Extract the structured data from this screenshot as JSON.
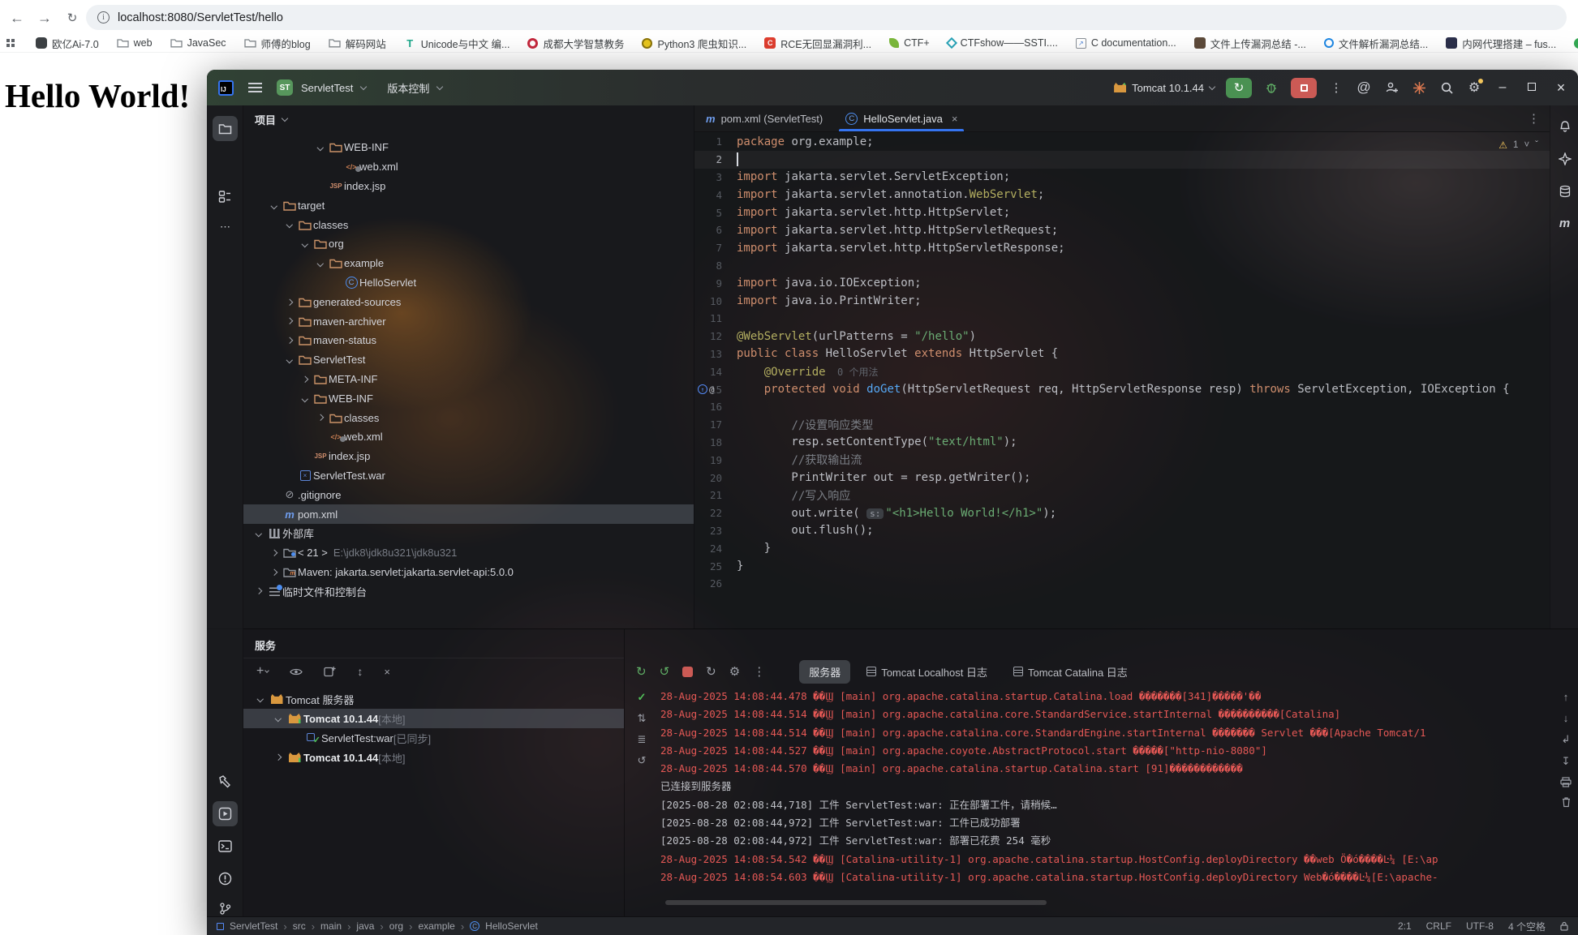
{
  "browser": {
    "url": "localhost:8080/ServletTest/hello",
    "page_heading": "Hello World!",
    "bookmarks": [
      {
        "icon": "ai-badge",
        "label": "欧亿Ai-7.0"
      },
      {
        "icon": "folder",
        "label": "web"
      },
      {
        "icon": "folder",
        "label": "JavaSec"
      },
      {
        "icon": "folder",
        "label": "师傅的blog"
      },
      {
        "icon": "folder",
        "label": "解码网站"
      },
      {
        "icon": "unicode-tool",
        "label": "Unicode与中文 编..."
      },
      {
        "icon": "red-ring",
        "label": "成都大学智慧教务"
      },
      {
        "icon": "python",
        "label": "Python3 爬虫知识..."
      },
      {
        "icon": "red-c",
        "label": "RCE无回显漏洞利..."
      },
      {
        "icon": "green-leaf",
        "label": "CTF+"
      },
      {
        "icon": "teal-diamond",
        "label": "CTFshow——SSTI...."
      },
      {
        "icon": "gray-doc",
        "label": "C documentation..."
      },
      {
        "icon": "dark-square",
        "label": "文件上传漏洞总结 -..."
      },
      {
        "icon": "blue-ring",
        "label": "文件解析漏洞总结..."
      },
      {
        "icon": "navy-square",
        "label": "内网代理搭建 – fus..."
      },
      {
        "icon": "green-dot",
        "label": ""
      }
    ]
  },
  "ide": {
    "title_bar": {
      "project_badge": "ST",
      "project_name": "ServletTest",
      "vcs_label": "版本控制",
      "run_config": "Tomcat 10.1.44"
    },
    "project_panel": {
      "header": "项目",
      "tree": [
        {
          "indent": 4,
          "chevron": "open",
          "icon": "folder",
          "label": "WEB-INF"
        },
        {
          "indent": 5,
          "chevron": null,
          "icon": "xml",
          "label": "web.xml"
        },
        {
          "indent": 4,
          "chevron": null,
          "icon": "jsp",
          "label": "index.jsp"
        },
        {
          "indent": 1,
          "chevron": "open",
          "icon": "folder",
          "label": "target"
        },
        {
          "indent": 2,
          "chevron": "open",
          "icon": "folder",
          "label": "classes"
        },
        {
          "indent": 3,
          "chevron": "open",
          "icon": "folder",
          "label": "org"
        },
        {
          "indent": 4,
          "chevron": "open",
          "icon": "folder",
          "label": "example"
        },
        {
          "indent": 5,
          "chevron": null,
          "icon": "class",
          "label": "HelloServlet"
        },
        {
          "indent": 2,
          "chevron": "closed",
          "icon": "folder",
          "label": "generated-sources"
        },
        {
          "indent": 2,
          "chevron": "closed",
          "icon": "folder",
          "label": "maven-archiver"
        },
        {
          "indent": 2,
          "chevron": "closed",
          "icon": "folder",
          "label": "maven-status"
        },
        {
          "indent": 2,
          "chevron": "open",
          "icon": "folder",
          "label": "ServletTest"
        },
        {
          "indent": 3,
          "chevron": "closed",
          "icon": "folder",
          "label": "META-INF"
        },
        {
          "indent": 3,
          "chevron": "open",
          "icon": "folder",
          "label": "WEB-INF"
        },
        {
          "indent": 4,
          "chevron": "closed",
          "icon": "folder",
          "label": "classes"
        },
        {
          "indent": 4,
          "chevron": null,
          "icon": "xml",
          "label": "web.xml"
        },
        {
          "indent": 3,
          "chevron": null,
          "icon": "jsp",
          "label": "index.jsp"
        },
        {
          "indent": 2,
          "chevron": null,
          "icon": "war",
          "label": "ServletTest.war"
        },
        {
          "indent": 1,
          "chevron": null,
          "icon": "ignore",
          "label": ".gitignore"
        },
        {
          "indent": 1,
          "chevron": null,
          "icon": "maven",
          "label": "pom.xml",
          "selected": true
        },
        {
          "indent": 0,
          "chevron": "open",
          "icon": "lib",
          "label": "外部库"
        },
        {
          "indent": 1,
          "chevron": "closed",
          "icon": "jdk",
          "label": "< 21 >",
          "extra": "E:\\jdk8\\jdk8u321\\jdk8u321"
        },
        {
          "indent": 1,
          "chevron": "closed",
          "icon": "libfolder",
          "label": "Maven: jakarta.servlet:jakarta.servlet-api:5.0.0"
        },
        {
          "indent": 0,
          "chevron": "closed",
          "icon": "scratch",
          "label": "临时文件和控制台"
        }
      ]
    },
    "editor": {
      "tabs": [
        {
          "icon": "maven",
          "label": "pom.xml (ServletTest)",
          "active": false
        },
        {
          "icon": "class",
          "label": "HelloServlet.java",
          "active": true,
          "closable": true
        }
      ],
      "warning_badge": "1",
      "lines": [
        {
          "n": 1,
          "t": [
            [
              "kw",
              "package "
            ],
            [
              "pl",
              "org.example;"
            ]
          ]
        },
        {
          "n": 2,
          "t": [
            [
              "caret",
              ""
            ]
          ],
          "current": true
        },
        {
          "n": 3,
          "t": [
            [
              "kw",
              "import "
            ],
            [
              "pl",
              "jakarta.servlet.ServletException;"
            ]
          ]
        },
        {
          "n": 4,
          "t": [
            [
              "kw",
              "import "
            ],
            [
              "pl",
              "jakarta.servlet.annotation."
            ],
            [
              "ann",
              "WebServlet"
            ],
            [
              "pl",
              ";"
            ]
          ]
        },
        {
          "n": 5,
          "t": [
            [
              "kw",
              "import "
            ],
            [
              "pl",
              "jakarta.servlet.http.HttpServlet;"
            ]
          ]
        },
        {
          "n": 6,
          "t": [
            [
              "kw",
              "import "
            ],
            [
              "pl",
              "jakarta.servlet.http.HttpServletRequest;"
            ]
          ]
        },
        {
          "n": 7,
          "t": [
            [
              "kw",
              "import "
            ],
            [
              "pl",
              "jakarta.servlet.http.HttpServletResponse;"
            ]
          ]
        },
        {
          "n": 8,
          "t": []
        },
        {
          "n": 9,
          "t": [
            [
              "kw",
              "import "
            ],
            [
              "pl",
              "java.io.IOException;"
            ]
          ]
        },
        {
          "n": 10,
          "t": [
            [
              "kw",
              "import "
            ],
            [
              "pl",
              "java.io.PrintWriter;"
            ]
          ]
        },
        {
          "n": 11,
          "t": []
        },
        {
          "n": 12,
          "t": [
            [
              "ann",
              "@WebServlet"
            ],
            [
              "pl",
              "(urlPatterns = "
            ],
            [
              "str",
              "\"/hello\""
            ],
            [
              "pl",
              ")"
            ]
          ]
        },
        {
          "n": 13,
          "t": [
            [
              "kw",
              "public class "
            ],
            [
              "pl",
              "HelloServlet "
            ],
            [
              "kw",
              "extends "
            ],
            [
              "pl",
              "HttpServlet {"
            ]
          ]
        },
        {
          "n": 14,
          "t": [
            [
              "pl",
              "    "
            ],
            [
              "ann",
              "@Override"
            ],
            [
              "hint",
              "  0 个用法"
            ]
          ]
        },
        {
          "n": 15,
          "t": [
            [
              "pl",
              "    "
            ],
            [
              "kw",
              "protected void "
            ],
            [
              "mth",
              "doGet"
            ],
            [
              "pl",
              "(HttpServletRequest req, HttpServletResponse resp) "
            ],
            [
              "kw",
              "throws "
            ],
            [
              "pl",
              "ServletException, IOException {"
            ]
          ],
          "gutter": [
            "override",
            "annotation"
          ]
        },
        {
          "n": 16,
          "t": []
        },
        {
          "n": 17,
          "t": [
            [
              "pl",
              "        "
            ],
            [
              "cmt",
              "//设置响应类型"
            ]
          ]
        },
        {
          "n": 18,
          "t": [
            [
              "pl",
              "        resp.setContentType("
            ],
            [
              "str",
              "\"text/html\""
            ],
            [
              "pl",
              ");"
            ]
          ]
        },
        {
          "n": 19,
          "t": [
            [
              "pl",
              "        "
            ],
            [
              "cmt",
              "//获取输出流"
            ]
          ]
        },
        {
          "n": 20,
          "t": [
            [
              "pl",
              "        PrintWriter out = resp.getWriter();"
            ]
          ]
        },
        {
          "n": 21,
          "t": [
            [
              "pl",
              "        "
            ],
            [
              "cmt",
              "//写入响应"
            ]
          ]
        },
        {
          "n": 22,
          "t": [
            [
              "pl",
              "        out.write( "
            ],
            [
              "badge",
              "s:"
            ],
            [
              "str",
              "\"<h1>Hello World!</h1>\""
            ],
            [
              "pl",
              ");"
            ]
          ]
        },
        {
          "n": 23,
          "t": [
            [
              "pl",
              "        out.flush();"
            ]
          ]
        },
        {
          "n": 24,
          "t": [
            [
              "pl",
              "    }"
            ]
          ]
        },
        {
          "n": 25,
          "t": [
            [
              "pl",
              "}"
            ]
          ]
        },
        {
          "n": 26,
          "t": []
        }
      ]
    },
    "services_panel": {
      "title": "服务",
      "tree": [
        {
          "indent": 0,
          "chevron": "open",
          "icon": "tomcat",
          "label": "Tomcat 服务器",
          "extra": "",
          "bold": false
        },
        {
          "indent": 1,
          "chevron": "open",
          "icon": "tomcat-run",
          "label": "Tomcat 10.1.44",
          "extra": " [本地]",
          "bold": true,
          "selected": true
        },
        {
          "indent": 2,
          "chevron": null,
          "icon": "artifact-ok",
          "label": "ServletTest:war",
          "extra": " [已同步]",
          "bold": false
        },
        {
          "indent": 1,
          "chevron": "closed",
          "icon": "tomcat-run",
          "label": "Tomcat 10.1.44",
          "extra": " [本地]",
          "bold": true
        }
      ]
    },
    "console": {
      "tabs": [
        {
          "icon": null,
          "label": "服务器",
          "active": true
        },
        {
          "icon": "log",
          "label": "Tomcat Localhost 日志",
          "active": false
        },
        {
          "icon": "log",
          "label": "Tomcat Catalina 日志",
          "active": false
        }
      ],
      "logs": [
        {
          "c": "err",
          "text": "28-Aug-2025 14:08:44.478 ��Ϣ [main] org.apache.catalina.startup.Catalina.load �������[341]�����'��"
        },
        {
          "c": "err",
          "text": "28-Aug-2025 14:08:44.514 ��Ϣ [main] org.apache.catalina.core.StandardService.startInternal ����������[Catalina]"
        },
        {
          "c": "err",
          "text": "28-Aug-2025 14:08:44.514 ��Ϣ [main] org.apache.catalina.core.StandardEngine.startInternal ������� Servlet ���[Apache Tomcat/1"
        },
        {
          "c": "err",
          "text": "28-Aug-2025 14:08:44.527 ��Ϣ [main] org.apache.coyote.AbstractProtocol.start �����[\"http-nio-8080\"]"
        },
        {
          "c": "err",
          "text": "28-Aug-2025 14:08:44.570 ��Ϣ [main] org.apache.catalina.startup.Catalina.start [91]������������"
        },
        {
          "c": "std",
          "text": "已连接到服务器"
        },
        {
          "c": "std",
          "text": "[2025-08-28 02:08:44,718] 工件 ServletTest:war: 正在部署工件，请稍候…"
        },
        {
          "c": "std",
          "text": "[2025-08-28 02:08:44,972] 工件 ServletTest:war: 工件已成功部署"
        },
        {
          "c": "std",
          "text": "[2025-08-28 02:08:44,972] 工件 ServletTest:war: 部署已花费 254 毫秒"
        },
        {
          "c": "err",
          "text": "28-Aug-2025 14:08:54.542 ��Ϣ [Catalina-utility-1] org.apache.catalina.startup.HostConfig.deployDirectory ��web Ӧ�ó����Ŀ¼ [E:\\ap"
        },
        {
          "c": "err",
          "text": "28-Aug-2025 14:08:54.603 ��Ϣ [Catalina-utility-1] org.apache.catalina.startup.HostConfig.deployDirectory Web�ó����Ŀ¼[E:\\apache-"
        }
      ]
    },
    "status_bar": {
      "breadcrumbs": [
        "ServletTest",
        "src",
        "main",
        "java",
        "org",
        "example",
        "HelloServlet"
      ],
      "right": [
        "2:1",
        "CRLF",
        "UTF-8",
        "4 个空格"
      ]
    }
  },
  "colors": {
    "accent_blue": "#3574f0",
    "run_green": "#4a9152",
    "stop_red": "#cb5a55",
    "error_log": "#e55855",
    "string_green": "#6aab73",
    "keyword_orange": "#cf8e6d"
  }
}
